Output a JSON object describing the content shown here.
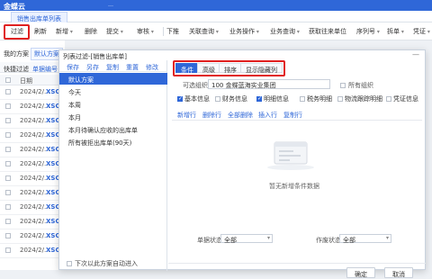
{
  "topbar": {
    "logo": "金蝶云",
    "text": "…"
  },
  "page_tab": "销售出库单列表",
  "toolbar": [
    "过滤",
    "刷新",
    "新增",
    "删除",
    "提交",
    "审核",
    "下推",
    "关联查询",
    "业务操作",
    "业务查询",
    "获取往来单位",
    "序列号",
    "拆单",
    "凭证"
  ],
  "left": {
    "my_scheme": "我的方案",
    "default_pill": "默认方案",
    "quick_filter": "快捷过滤",
    "doc_no_tab": "单据编号",
    "date_header": "日期",
    "rows": [
      {
        "date": "2024/2/...",
        "no": "XSCK"
      },
      {
        "date": "2024/2/...",
        "no": "XSCK"
      },
      {
        "date": "2024/2/...",
        "no": "XSCK"
      },
      {
        "date": "2024/2/...",
        "no": "XSCK"
      },
      {
        "date": "2024/2/...",
        "no": "XSCK"
      },
      {
        "date": "2024/2/...",
        "no": "XSCK"
      },
      {
        "date": "2024/2/...",
        "no": "XSCK"
      },
      {
        "date": "2024/2/...",
        "no": "XSCK"
      },
      {
        "date": "2024/2/...",
        "no": "XSCK"
      },
      {
        "date": "2024/2/...",
        "no": "XSCK"
      },
      {
        "date": "2024/2/...",
        "no": "XSCK"
      },
      {
        "date": "2024/2/...",
        "no": "XSCK"
      }
    ]
  },
  "dialog": {
    "title": "列表过滤-[销售出库单]",
    "min_icon": "—",
    "scheme_actions": [
      "保存",
      "另存",
      "复制",
      "重置",
      "修改"
    ],
    "scheme_items": [
      "默认方案",
      "今天",
      "本周",
      "本月",
      "本月待确认应收的出库单",
      "所有被拒出库单(90天)"
    ],
    "footer_check": "下次以此方案自动进入",
    "tabs": [
      "条件",
      "高级",
      "排序",
      "显示隐藏列"
    ],
    "org_label": "可选组织",
    "org_value": "100 金蝶蓝海实业集团",
    "org_all": "所有组织",
    "checks": [
      {
        "label": "基本信息",
        "on": true
      },
      {
        "label": "财务信息",
        "on": false
      },
      {
        "label": "明细信息",
        "on": true
      },
      {
        "label": "税务明细",
        "on": false
      },
      {
        "label": "物流跟踪明细",
        "on": false
      },
      {
        "label": "凭证信息",
        "on": false
      }
    ],
    "row_actions": [
      "新增行",
      "删除行",
      "全部删除",
      "插入行",
      "复制行"
    ],
    "empty_text": "暂无新增条件数据",
    "doc_status_label": "单据状态",
    "doc_status_value": "全部",
    "void_status_label": "作废状态",
    "void_status_value": "全部",
    "ok_label": "确定",
    "cancel_label": "取消"
  }
}
